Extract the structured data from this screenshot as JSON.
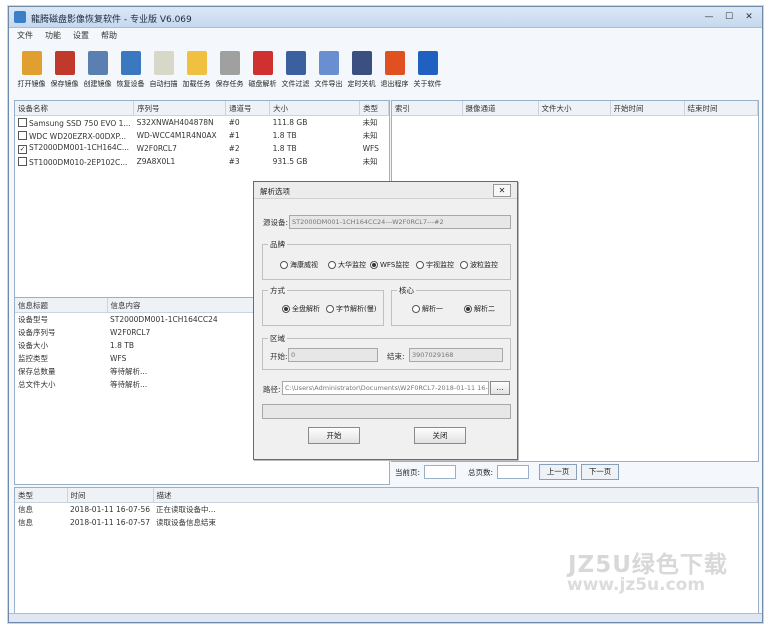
{
  "window": {
    "title": "龍腾磁盘影像恢复软件 - 专业版 V6.069"
  },
  "menu": [
    "文件",
    "功能",
    "设置",
    "帮助"
  ],
  "toolbar": [
    {
      "label": "打开镜像",
      "icon": "open-image-icon",
      "color": "#e0a030"
    },
    {
      "label": "保存镜像",
      "icon": "save-image-icon",
      "color": "#c0392b"
    },
    {
      "label": "创建镜像",
      "icon": "create-image-icon",
      "color": "#5a7fb0"
    },
    {
      "label": "恢复设备",
      "icon": "restore-device-icon",
      "color": "#3a78c0"
    },
    {
      "label": "自动扫描",
      "icon": "auto-scan-icon",
      "color": "#d8d8c8"
    },
    {
      "label": "加载任务",
      "icon": "load-task-icon",
      "color": "#f0c040"
    },
    {
      "label": "保存任务",
      "icon": "save-task-icon",
      "color": "#a0a0a0"
    },
    {
      "label": "磁盘解析",
      "icon": "disk-parse-icon",
      "color": "#d03030"
    },
    {
      "label": "文件过滤",
      "icon": "file-filter-icon",
      "color": "#3a60a0"
    },
    {
      "label": "文件导出",
      "icon": "file-export-icon",
      "color": "#6a8fd0"
    },
    {
      "label": "定时关机",
      "icon": "timer-shutdown-icon",
      "color": "#3a5080"
    },
    {
      "label": "退出程序",
      "icon": "exit-icon",
      "color": "#e05020"
    },
    {
      "label": "关于软件",
      "icon": "about-icon",
      "color": "#2060c0"
    }
  ],
  "devices": {
    "headers": [
      "设备名称",
      "序列号",
      "通道号",
      "大小",
      "类型"
    ],
    "rows": [
      {
        "checked": false,
        "name": "Samsung SSD 750 EVO 1...",
        "serial": "S32XNWAH404878N",
        "channel": "#0",
        "size": "111.8 GB",
        "type": "未知"
      },
      {
        "checked": false,
        "name": "WDC WD20EZRX-00DXP...",
        "serial": "WD-WCC4M1R4N0AX",
        "channel": "#1",
        "size": "1.8 TB",
        "type": "未知"
      },
      {
        "checked": true,
        "name": "ST2000DM001-1CH164C...",
        "serial": "W2F0RCL7",
        "channel": "#2",
        "size": "1.8 TB",
        "type": "WFS"
      },
      {
        "checked": false,
        "name": "ST1000DM010-2EP102C...",
        "serial": "Z9A8X0L1",
        "channel": "#3",
        "size": "931.5 GB",
        "type": "未知"
      }
    ]
  },
  "files": {
    "headers": [
      "索引",
      "摄像通道",
      "文件大小",
      "开始时间",
      "结束时间"
    ]
  },
  "info": {
    "headers": [
      "信息标题",
      "信息内容"
    ],
    "rows": [
      {
        "k": "设备型号",
        "v": "ST2000DM001-1CH164CC24"
      },
      {
        "k": "设备序列号",
        "v": "W2F0RCL7"
      },
      {
        "k": "设备大小",
        "v": "1.8 TB"
      },
      {
        "k": "监控类型",
        "v": "WFS"
      },
      {
        "k": "保存总数量",
        "v": "等待解析..."
      },
      {
        "k": "总文件大小",
        "v": "等待解析..."
      }
    ]
  },
  "pager": {
    "current_label": "当前页:",
    "total_label": "总页数:",
    "prev": "上一页",
    "next": "下一页"
  },
  "log": {
    "headers": [
      "类型",
      "时间",
      "描述"
    ],
    "rows": [
      {
        "type": "信息",
        "time": "2018-01-11 16-07-56",
        "desc": "正在读取设备中..."
      },
      {
        "type": "信息",
        "time": "2018-01-11 16-07-57",
        "desc": "读取设备信息结束"
      }
    ]
  },
  "dialog": {
    "title": "解析选项",
    "source_label": "源设备:",
    "source_value": "ST2000DM001-1CH164CC24---W2F0RCL7---#2",
    "brand_group": "品牌",
    "brands": [
      "海康威视",
      "大华监控",
      "WFS监控",
      "宇视监控",
      "波粒监控"
    ],
    "brand_selected": 2,
    "mode_group": "方式",
    "modes": [
      "全盘解析",
      "字节解析(慢)"
    ],
    "mode_selected": 0,
    "engine_group": "核心",
    "engines": [
      "解析一",
      "解析二"
    ],
    "engine_selected": 1,
    "range_group": "区域",
    "start_label": "开始:",
    "start_value": "0",
    "end_label": "结束:",
    "end_value": "3907029168",
    "path_label": "路径:",
    "path_value": "C:\\Users\\Administrator\\Documents\\W2F0RCL7-2018-01-11 16-58-02.tsk",
    "browse": "...",
    "start_btn": "开始",
    "close_btn": "关闭"
  },
  "watermark": {
    "line1": "JZ5U绿色下载",
    "line2": "www.jz5u.com"
  }
}
